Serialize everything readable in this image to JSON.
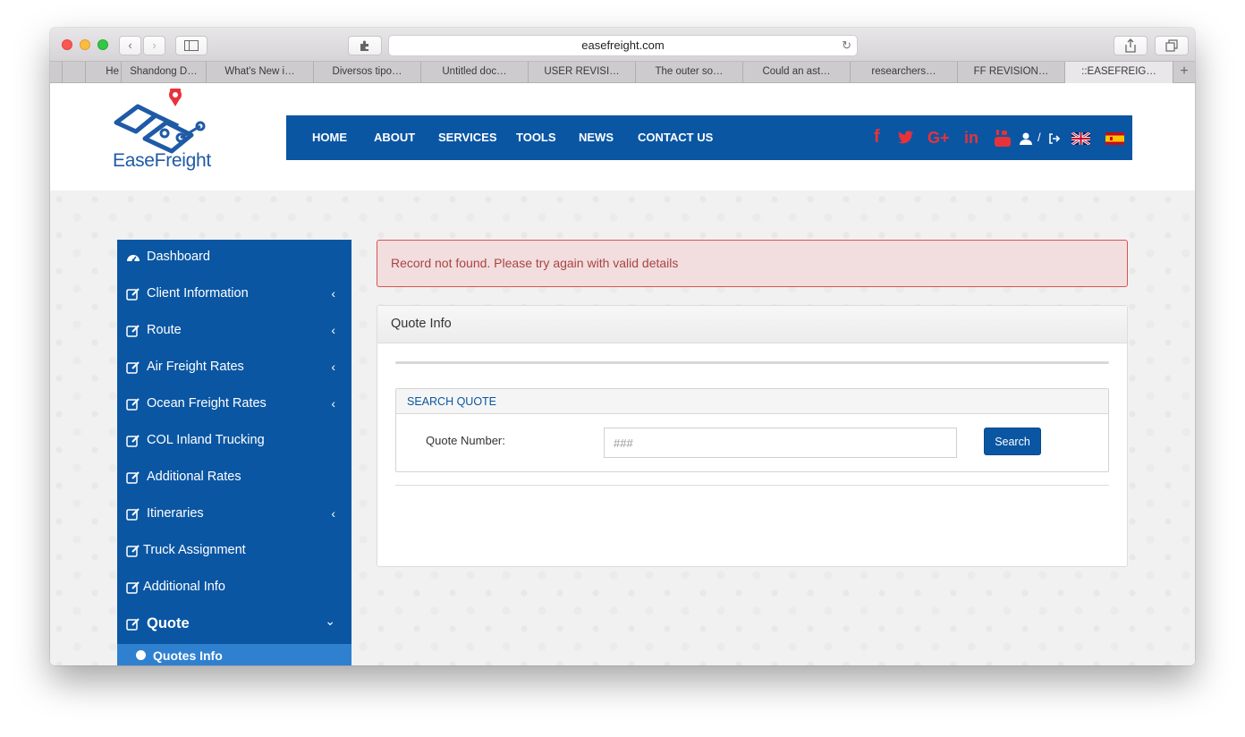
{
  "browser": {
    "url": "easefreight.com",
    "tabs": [
      {
        "label": "He",
        "width": 80
      },
      {
        "label": "Shandong D…"
      },
      {
        "label": "What's New i…"
      },
      {
        "label": "Diversos tipo…"
      },
      {
        "label": "Untitled doc…"
      },
      {
        "label": "USER REVISI…"
      },
      {
        "label": "The outer so…"
      },
      {
        "label": "Could an ast…"
      },
      {
        "label": "researchers…"
      },
      {
        "label": "FF REVISION…"
      },
      {
        "label": "::EASEFREIG…"
      }
    ],
    "new_tab": "+"
  },
  "site": {
    "logo_text": "EaseFreight",
    "brand_color": "#0a56a3",
    "nav": [
      "HOME",
      "ABOUT",
      "SERVICES",
      "TOOLS",
      "NEWS",
      "CONTACT US"
    ],
    "social_icons": [
      "facebook-icon",
      "twitter-icon",
      "google-plus-icon",
      "linkedin-icon",
      "youtube-icon"
    ],
    "user_sep": "/"
  },
  "sidebar": {
    "items": [
      {
        "label": "Dashboard",
        "icon": "dashboard-icon",
        "chevron": ""
      },
      {
        "label": "Client Information",
        "icon": "edit-icon",
        "chevron": "‹"
      },
      {
        "label": "Route",
        "icon": "edit-icon",
        "chevron": "‹"
      },
      {
        "label": "Air Freight Rates",
        "icon": "edit-icon",
        "chevron": "‹"
      },
      {
        "label": "Ocean Freight Rates",
        "icon": "edit-icon",
        "chevron": "‹"
      },
      {
        "label": "COL Inland Trucking",
        "icon": "edit-icon",
        "chevron": ""
      },
      {
        "label": "Additional Rates",
        "icon": "edit-icon",
        "chevron": ""
      },
      {
        "label": "Itineraries",
        "icon": "edit-icon",
        "chevron": "‹"
      },
      {
        "label": "Truck Assignment",
        "icon": "edit-icon",
        "chevron": ""
      },
      {
        "label": "Additional Info",
        "icon": "edit-icon",
        "chevron": ""
      },
      {
        "label": "Quote",
        "icon": "edit-icon",
        "chevron": "⌄"
      }
    ],
    "sub_item": "Quotes Info"
  },
  "main": {
    "alert": "Record not found. Please try again with valid details",
    "panel_title": "Quote Info",
    "search": {
      "section_title": "SEARCH QUOTE",
      "field_label": "Quote Number:",
      "placeholder": "###",
      "button": "Search"
    }
  }
}
